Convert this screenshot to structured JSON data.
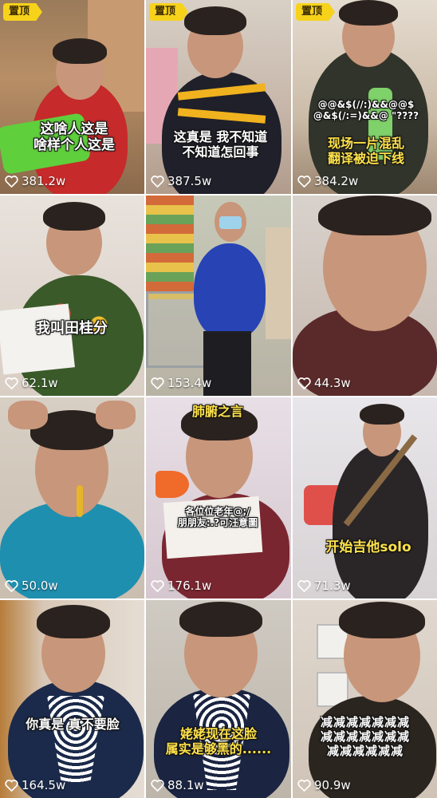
{
  "pin_label": "置顶",
  "tiles": [
    {
      "caption": "这啥人这是\n啥样个人这是",
      "likes": "381.2w",
      "pinned": true
    },
    {
      "caption": "这真是 我不知道\n不知道怎回事",
      "likes": "387.5w",
      "pinned": true
    },
    {
      "caption": "现场一片混乱\n翻译被迫下线",
      "symbols": "@@&$(//:)&&@@$\n@&$(/:=)&&@ \"????",
      "likes": "384.2w",
      "pinned": true
    },
    {
      "caption": "我叫田桂分",
      "likes": "62.1w",
      "pinned": false
    },
    {
      "caption": "",
      "likes": "153.4w",
      "pinned": false
    },
    {
      "caption": "",
      "likes": "44.3w",
      "pinned": false
    },
    {
      "caption": "",
      "likes": "50.0w",
      "pinned": false
    },
    {
      "caption": "肺腑之言",
      "caption_top_partial": "肺腑之言",
      "paper_text": "各位位老年@;/\n朋朋友:.?可汪意圖",
      "likes": "176.1w",
      "pinned": false
    },
    {
      "caption": "开始吉他solo",
      "likes": "71.3w",
      "pinned": false
    },
    {
      "caption": "你真是 真不要脸",
      "likes": "164.5w",
      "pinned": false
    },
    {
      "caption": "姥姥现在这脸\n属实是够黑的......",
      "likes": "88.1w",
      "pinned": false
    },
    {
      "caption": "减减减减减减减\n减减减减减减减\n减减减减减减",
      "likes": "90.9w",
      "pinned": false
    }
  ],
  "colors": {
    "pin": "#f7d21b",
    "caption_yellow": "#ffe24a",
    "caption_white": "#ffffff"
  }
}
